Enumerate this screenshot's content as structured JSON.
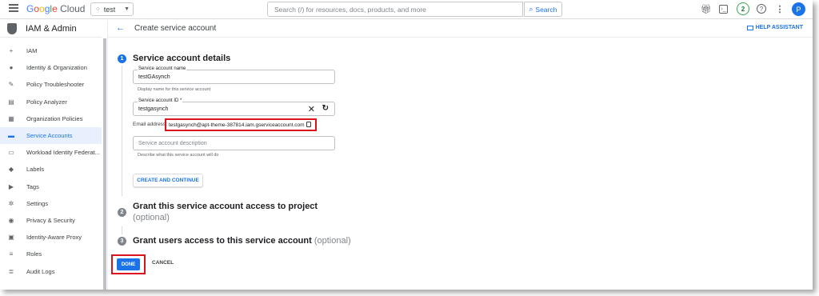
{
  "topbar": {
    "logo": [
      "G",
      "o",
      "o",
      "g",
      "l",
      "e"
    ],
    "logo_cloud": "Cloud",
    "project": "test",
    "search_placeholder": "Search (/) for resources, docs, products, and more",
    "search_button": "Search",
    "notification_count": "2",
    "avatar_letter": "P"
  },
  "sidebar": {
    "title": "IAM & Admin",
    "items": [
      {
        "label": "IAM",
        "icon": "add-person-icon",
        "glyph": "+"
      },
      {
        "label": "Identity & Organization",
        "icon": "account-circle-icon",
        "glyph": "●"
      },
      {
        "label": "Policy Troubleshooter",
        "icon": "wrench-icon",
        "glyph": "✎"
      },
      {
        "label": "Policy Analyzer",
        "icon": "document-search-icon",
        "glyph": "▤"
      },
      {
        "label": "Organization Policies",
        "icon": "list-document-icon",
        "glyph": "▦"
      },
      {
        "label": "Service Accounts",
        "icon": "service-account-icon",
        "glyph": "▬"
      },
      {
        "label": "Workload Identity Federat...",
        "icon": "id-card-icon",
        "glyph": "▭"
      },
      {
        "label": "Labels",
        "icon": "label-icon",
        "glyph": "◆"
      },
      {
        "label": "Tags",
        "icon": "tag-icon",
        "glyph": "▶"
      },
      {
        "label": "Settings",
        "icon": "gear-icon",
        "glyph": "✲"
      },
      {
        "label": "Privacy & Security",
        "icon": "shield-icon",
        "glyph": "◉"
      },
      {
        "label": "Identity-Aware Proxy",
        "icon": "proxy-icon",
        "glyph": "▣"
      },
      {
        "label": "Roles",
        "icon": "roles-icon",
        "glyph": "≡"
      },
      {
        "label": "Audit Logs",
        "icon": "audit-logs-icon",
        "glyph": "≣"
      }
    ],
    "active_index": 5
  },
  "page": {
    "title": "Create service account",
    "help_assistant": "HELP ASSISTANT"
  },
  "steps": [
    {
      "number": "1",
      "title": "Service account details",
      "optional": ""
    },
    {
      "number": "2",
      "title": "Grant this service account access to project",
      "optional": "(optional)"
    },
    {
      "number": "3",
      "title": "Grant users access to this service account",
      "optional": "(optional)"
    }
  ],
  "form": {
    "name_label": "Service account name",
    "name_value": "testGAsynch",
    "name_helper": "Display name for this service account",
    "id_label": "Service account ID *",
    "id_value": "testgasynch",
    "email_label": "Email address:",
    "email_value": "testgasynch@apt-theme-387814.iam.gserviceaccount.com",
    "description_placeholder": "Service account description",
    "description_helper": "Describe what this service account will do",
    "create_continue": "CREATE AND CONTINUE"
  },
  "footer": {
    "done": "DONE",
    "cancel": "CANCEL"
  },
  "colors": {
    "accent": "#1a73e8",
    "highlight_border": "#d9141d"
  }
}
